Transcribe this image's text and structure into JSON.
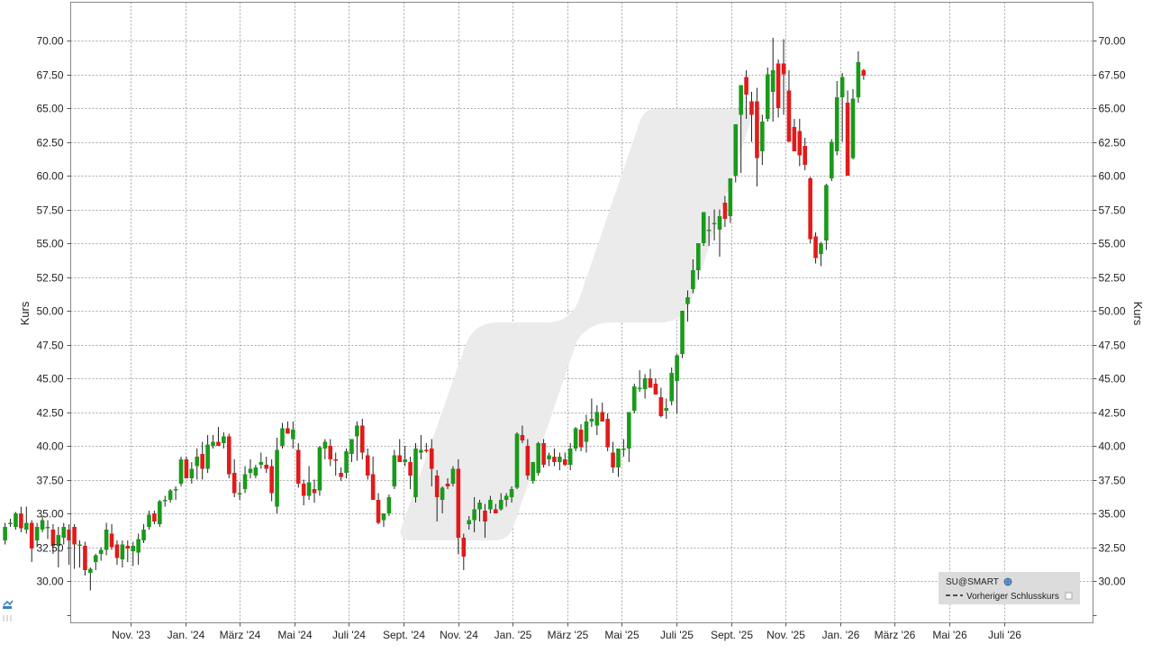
{
  "chart_data": {
    "type": "candlestick",
    "xlabel": "",
    "ylabel": "Kurs",
    "ylim": [
      27.5,
      72.5
    ],
    "y_ticks": [
      "30.00",
      "32.50",
      "35.00",
      "37.50",
      "40.00",
      "42.50",
      "45.00",
      "47.50",
      "50.00",
      "52.50",
      "55.00",
      "57.50",
      "60.00",
      "62.50",
      "65.00",
      "67.50",
      "70.00"
    ],
    "x_ticks": [
      "Nov. '23",
      "Jan. '24",
      "März '24",
      "Mai '24",
      "Juli '24",
      "Sept. '24",
      "Nov. '24",
      "Jan. '25",
      "März '25",
      "Mai '25",
      "Juli '25",
      "Sept. '25",
      "Nov. '25",
      "Jan. '26",
      "März '26",
      "Mai '26",
      "Juli '26"
    ],
    "grid": true,
    "legend": {
      "placement": "bottom-right",
      "title": "SU@SMART",
      "entries": [
        {
          "label": "Vorheriger Schlusskurs",
          "style": "dashed"
        }
      ]
    },
    "colors": {
      "up": "#1a9a1a",
      "down": "#e01b1b",
      "wick": "#222222",
      "grid": "#a8a8a8",
      "watermark": "#ebebeb"
    },
    "candle_x_start": -2.3,
    "candle_x_step": 0.0977,
    "ohlc": [
      [
        33.0,
        34.3,
        32.7,
        34.0
      ],
      [
        34.2,
        34.6,
        34.0,
        34.3
      ],
      [
        34.0,
        35.1,
        33.8,
        35.0
      ],
      [
        35.0,
        35.5,
        33.6,
        33.9
      ],
      [
        33.8,
        35.5,
        33.5,
        34.3
      ],
      [
        34.3,
        34.5,
        31.4,
        32.4
      ],
      [
        33.0,
        34.3,
        32.5,
        34.0
      ],
      [
        33.8,
        34.8,
        33.6,
        34.5
      ],
      [
        34.0,
        34.5,
        33.1,
        34.0
      ],
      [
        33.8,
        34.2,
        32.0,
        32.6
      ],
      [
        32.6,
        34.0,
        31.0,
        33.4
      ],
      [
        33.2,
        34.3,
        32.7,
        34.0
      ],
      [
        33.8,
        34.2,
        31.2,
        33.0
      ],
      [
        34.0,
        34.2,
        30.9,
        32.7
      ],
      [
        32.6,
        33.0,
        31.0,
        32.7
      ],
      [
        32.6,
        32.9,
        30.4,
        30.8
      ],
      [
        30.6,
        31.0,
        29.3,
        30.9
      ],
      [
        31.4,
        32.0,
        30.8,
        31.9
      ],
      [
        32.0,
        32.5,
        31.5,
        32.3
      ],
      [
        32.3,
        34.3,
        31.9,
        33.8
      ],
      [
        33.5,
        34.2,
        32.3,
        32.5
      ],
      [
        32.7,
        33.0,
        31.2,
        31.7
      ],
      [
        31.6,
        33.0,
        31.0,
        32.7
      ],
      [
        32.6,
        33.0,
        31.4,
        32.4
      ],
      [
        32.2,
        32.9,
        31.1,
        32.6
      ],
      [
        32.1,
        33.5,
        31.2,
        33.1
      ],
      [
        33.0,
        34.2,
        32.8,
        33.8
      ],
      [
        34.0,
        35.2,
        33.8,
        34.9
      ],
      [
        35.0,
        35.2,
        34.2,
        34.4
      ],
      [
        34.2,
        36.0,
        34.0,
        35.9
      ],
      [
        36.0,
        36.3,
        35.5,
        36.0
      ],
      [
        36.0,
        36.8,
        35.8,
        36.7
      ],
      [
        36.8,
        37.0,
        36.0,
        36.8
      ],
      [
        37.2,
        39.2,
        37.0,
        39.0
      ],
      [
        39.0,
        39.2,
        38.0,
        37.6
      ],
      [
        37.6,
        38.8,
        37.2,
        38.3
      ],
      [
        38.5,
        39.8,
        37.5,
        39.2
      ],
      [
        39.4,
        40.3,
        37.5,
        38.3
      ],
      [
        38.3,
        40.8,
        38.0,
        40.1
      ],
      [
        40.0,
        40.8,
        39.8,
        40.3
      ],
      [
        40.3,
        41.4,
        40.0,
        40.0
      ],
      [
        40.2,
        41.0,
        39.8,
        40.7
      ],
      [
        40.7,
        40.9,
        37.6,
        37.9
      ],
      [
        38.0,
        39.0,
        36.2,
        36.5
      ],
      [
        36.5,
        37.3,
        36.0,
        36.5
      ],
      [
        36.8,
        38.5,
        36.5,
        37.9
      ],
      [
        38.0,
        39.0,
        37.6,
        38.3
      ],
      [
        37.8,
        38.6,
        37.6,
        38.4
      ],
      [
        38.6,
        39.5,
        38.3,
        38.8
      ],
      [
        38.6,
        39.2,
        38.0,
        38.3
      ],
      [
        38.5,
        39.0,
        35.9,
        36.5
      ],
      [
        35.5,
        40.6,
        35.0,
        39.7
      ],
      [
        40.0,
        41.7,
        39.8,
        41.3
      ],
      [
        41.3,
        41.8,
        41.0,
        40.9
      ],
      [
        40.5,
        41.8,
        39.8,
        41.2
      ],
      [
        39.7,
        40.2,
        36.9,
        37.2
      ],
      [
        37.2,
        37.5,
        35.6,
        36.3
      ],
      [
        36.3,
        38.5,
        36.0,
        37.3
      ],
      [
        36.8,
        37.5,
        35.8,
        36.5
      ],
      [
        36.7,
        40.0,
        36.3,
        39.9
      ],
      [
        39.8,
        40.5,
        39.0,
        40.3
      ],
      [
        40.0,
        40.5,
        38.5,
        39.0
      ],
      [
        39.0,
        39.5,
        37.8,
        38.9
      ],
      [
        38.0,
        38.4,
        37.4,
        37.7
      ],
      [
        38.0,
        39.8,
        37.6,
        39.6
      ],
      [
        39.4,
        40.2,
        38.8,
        40.5
      ],
      [
        40.7,
        41.8,
        38.9,
        41.5
      ],
      [
        41.5,
        42.0,
        39.0,
        39.5
      ],
      [
        39.3,
        39.8,
        37.5,
        37.8
      ],
      [
        37.9,
        39.2,
        36.7,
        36.0
      ],
      [
        36.0,
        36.5,
        34.2,
        34.3
      ],
      [
        34.5,
        35.0,
        34.0,
        35.0
      ],
      [
        35.0,
        36.4,
        34.8,
        36.2
      ],
      [
        37.0,
        39.7,
        36.8,
        39.3
      ],
      [
        39.3,
        40.5,
        38.8,
        38.8
      ],
      [
        38.8,
        40.0,
        38.5,
        39.0
      ],
      [
        38.8,
        39.2,
        36.8,
        37.8
      ],
      [
        36.2,
        40.2,
        35.8,
        39.8
      ],
      [
        39.5,
        40.8,
        39.0,
        39.7
      ],
      [
        39.7,
        40.2,
        39.5,
        39.6
      ],
      [
        39.8,
        40.5,
        37.0,
        38.3
      ],
      [
        37.8,
        38.2,
        34.4,
        36.2
      ],
      [
        36.0,
        37.0,
        35.0,
        36.9
      ],
      [
        37.2,
        37.6,
        36.8,
        37.0
      ],
      [
        37.2,
        38.5,
        37.0,
        38.3
      ],
      [
        38.3,
        39.0,
        32.0,
        33.2
      ],
      [
        33.2,
        33.5,
        30.8,
        31.8
      ],
      [
        34.2,
        34.8,
        33.8,
        34.5
      ],
      [
        34.5,
        36.2,
        33.6,
        35.3
      ],
      [
        35.3,
        36.0,
        34.4,
        35.8
      ],
      [
        35.2,
        35.7,
        33.2,
        34.4
      ],
      [
        35.3,
        36.3,
        35.0,
        36.0
      ],
      [
        35.3,
        35.7,
        35.0,
        35.0
      ],
      [
        35.3,
        36.5,
        35.2,
        36.0
      ],
      [
        36.0,
        36.5,
        35.5,
        36.3
      ],
      [
        36.2,
        37.0,
        35.8,
        36.8
      ],
      [
        36.9,
        41.0,
        36.8,
        40.9
      ],
      [
        40.8,
        41.5,
        40.2,
        40.4
      ],
      [
        40.0,
        40.5,
        37.5,
        37.8
      ],
      [
        37.4,
        38.8,
        37.2,
        38.8
      ],
      [
        38.0,
        40.3,
        37.8,
        40.2
      ],
      [
        40.2,
        40.5,
        38.4,
        38.6
      ],
      [
        39.0,
        39.5,
        38.5,
        39.3
      ],
      [
        39.2,
        39.8,
        38.5,
        38.8
      ],
      [
        38.8,
        39.5,
        38.2,
        39.2
      ],
      [
        39.0,
        39.5,
        38.5,
        38.6
      ],
      [
        38.6,
        40.2,
        38.2,
        39.8
      ],
      [
        39.8,
        41.4,
        39.6,
        41.3
      ],
      [
        41.2,
        41.6,
        39.6,
        39.9
      ],
      [
        40.3,
        42.3,
        39.5,
        41.8
      ],
      [
        41.8,
        43.5,
        41.4,
        42.0
      ],
      [
        41.5,
        43.0,
        40.8,
        42.5
      ],
      [
        42.5,
        43.2,
        41.8,
        41.8
      ],
      [
        42.0,
        42.4,
        39.6,
        39.9
      ],
      [
        39.5,
        40.3,
        38.0,
        38.4
      ],
      [
        38.4,
        39.8,
        37.7,
        39.8
      ],
      [
        39.8,
        40.5,
        39.2,
        39.8
      ],
      [
        39.8,
        40.6,
        38.8,
        42.5
      ],
      [
        42.6,
        44.6,
        42.4,
        44.4
      ],
      [
        44.3,
        45.6,
        44.0,
        44.3
      ],
      [
        44.2,
        45.3,
        43.5,
        45.0
      ],
      [
        45.0,
        45.7,
        44.3,
        44.3
      ],
      [
        44.6,
        45.0,
        43.8,
        43.8
      ],
      [
        43.6,
        44.3,
        42.1,
        42.2
      ],
      [
        42.6,
        43.5,
        42.0,
        42.8
      ],
      [
        43.3,
        45.8,
        43.0,
        45.4
      ],
      [
        44.8,
        46.8,
        42.4,
        46.7
      ],
      [
        46.8,
        48.8,
        46.5,
        50.0
      ],
      [
        50.5,
        51.5,
        49.2,
        51.0
      ],
      [
        51.6,
        53.8,
        51.3,
        53.0
      ],
      [
        53.0,
        55.0,
        52.3,
        55.0
      ],
      [
        55.0,
        56.5,
        54.8,
        57.3
      ],
      [
        56.0,
        57.0,
        54.8,
        56.0
      ],
      [
        56.5,
        57.5,
        55.2,
        56.5
      ],
      [
        56.0,
        57.5,
        54.0,
        57.0
      ],
      [
        58.0,
        58.5,
        56.2,
        56.8
      ],
      [
        57.0,
        59.8,
        56.5,
        59.8
      ],
      [
        60.0,
        62.0,
        59.5,
        63.8
      ],
      [
        64.5,
        65.0,
        60.2,
        66.7
      ],
      [
        67.3,
        67.8,
        64.2,
        66.0
      ],
      [
        65.5,
        66.2,
        62.5,
        64.5
      ],
      [
        65.5,
        66.5,
        59.2,
        61.3
      ],
      [
        61.8,
        64.5,
        60.8,
        64.0
      ],
      [
        64.2,
        68.0,
        64.0,
        67.5
      ],
      [
        66.2,
        70.2,
        64.0,
        67.8
      ],
      [
        68.3,
        68.6,
        64.3,
        65.0
      ],
      [
        68.3,
        70.1,
        64.5,
        67.5
      ],
      [
        66.3,
        67.8,
        62.5,
        62.5
      ],
      [
        63.6,
        64.2,
        61.8,
        61.8
      ],
      [
        63.3,
        64.2,
        60.7,
        61.5
      ],
      [
        62.2,
        62.8,
        60.4,
        60.8
      ],
      [
        59.8,
        59.9,
        55.0,
        55.3
      ],
      [
        55.5,
        55.8,
        53.5,
        53.9
      ],
      [
        54.2,
        55.1,
        53.3,
        55.0
      ],
      [
        55.2,
        59.4,
        54.5,
        59.3
      ],
      [
        59.8,
        62.7,
        59.6,
        62.5
      ],
      [
        61.8,
        67.0,
        61.5,
        65.8
      ],
      [
        65.8,
        67.6,
        62.5,
        67.3
      ],
      [
        65.4,
        66.3,
        60.0,
        60.0
      ],
      [
        61.3,
        66.4,
        61.2,
        65.7
      ],
      [
        65.8,
        69.2,
        65.4,
        68.4
      ],
      [
        67.8,
        67.9,
        67.1,
        67.4
      ]
    ]
  }
}
